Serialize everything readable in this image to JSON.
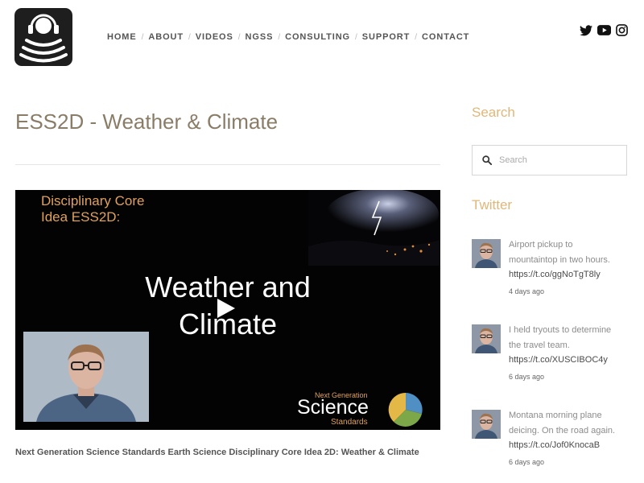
{
  "nav": {
    "items": [
      {
        "label": "HOME"
      },
      {
        "label": "ABOUT"
      },
      {
        "label": "VIDEOS"
      },
      {
        "label": "NGSS"
      },
      {
        "label": "CONSULTING"
      },
      {
        "label": "SUPPORT"
      },
      {
        "label": "CONTACT"
      }
    ]
  },
  "social": [
    "twitter-icon",
    "youtube-icon",
    "instagram-icon"
  ],
  "page": {
    "title": "ESS2D - Weather & Climate",
    "caption": "Next Generation Science Standards Earth Science Disciplinary Core Idea 2D:  Weather & Climate"
  },
  "video": {
    "dci_line1": "Disciplinary Core",
    "dci_line2": "Idea ESS2D:",
    "title_line1": "Weather and",
    "title_line2": "Climate",
    "badge_line1": "Next Generation",
    "badge_line2": "Science",
    "badge_line3": "Standards"
  },
  "sidebar": {
    "search_heading": "Search",
    "search_placeholder": "Search",
    "twitter_heading": "Twitter",
    "tweets": [
      {
        "line1": "Airport pickup to",
        "line2": "mountaintop in two hours.",
        "link": "https://t.co/ggNoTgT8ly",
        "ago": "4 days ago"
      },
      {
        "line1": "I held tryouts to determine",
        "line2": "the travel team.",
        "link": "https://t.co/XUSCIBOC4y",
        "ago": "6 days ago"
      },
      {
        "line1": "Montana morning plane",
        "line2": "deicing. On the road again.",
        "link": "https://t.co/Jof0KnocaB",
        "ago": "6 days ago"
      }
    ]
  },
  "colors": {
    "title": "#8a7d68",
    "sidebar_heading": "#e0b77a",
    "video_accent": "#e0a15c",
    "logo_bg": "#1e1e1e"
  }
}
